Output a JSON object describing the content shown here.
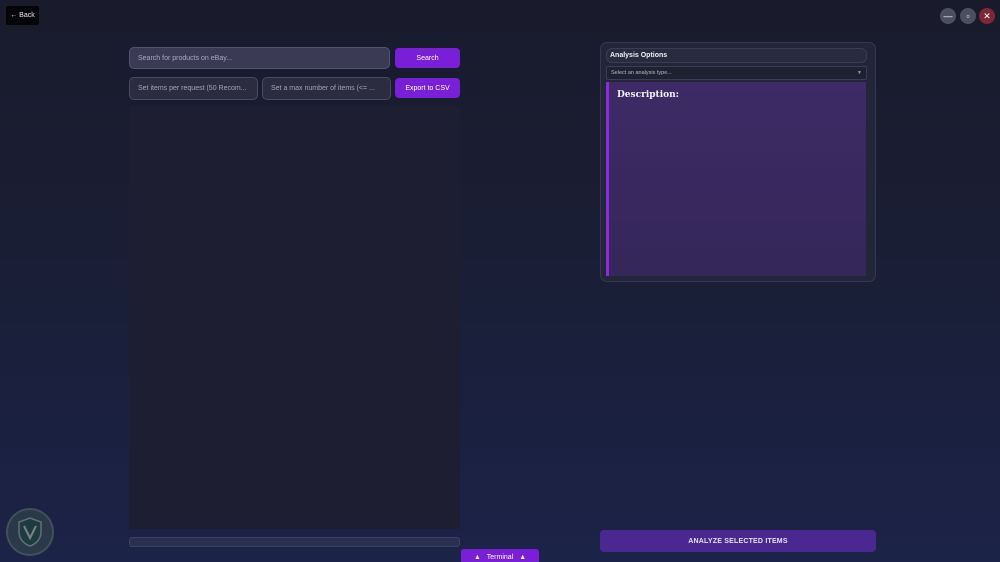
{
  "header": {
    "back_label": "← Back"
  },
  "window_controls": {
    "minimize_icon": "—",
    "maximize_icon": "▫",
    "close_icon": "✕",
    "close_color": "#7c2836"
  },
  "search": {
    "placeholder": "Search for products on eBay...",
    "button_label": "Search"
  },
  "options": {
    "items_per_request_placeholder": "Set items per request (50 Recom...",
    "max_items_placeholder": "Set a max number of items (<= ...",
    "export_label": "Export to CSV"
  },
  "terminal": {
    "label": "Terminal",
    "arrow": "▲"
  },
  "analysis": {
    "title": "Analysis Options",
    "select_placeholder": "Select an analysis type...",
    "description_label": "Description:",
    "analyze_button": "ANALYZE SELECTED ITEMS"
  },
  "progress": {
    "value": 0
  },
  "colors": {
    "accent": "#7a1fd8",
    "analyze_button": "#4b2790",
    "description_border": "#8a2be2"
  }
}
